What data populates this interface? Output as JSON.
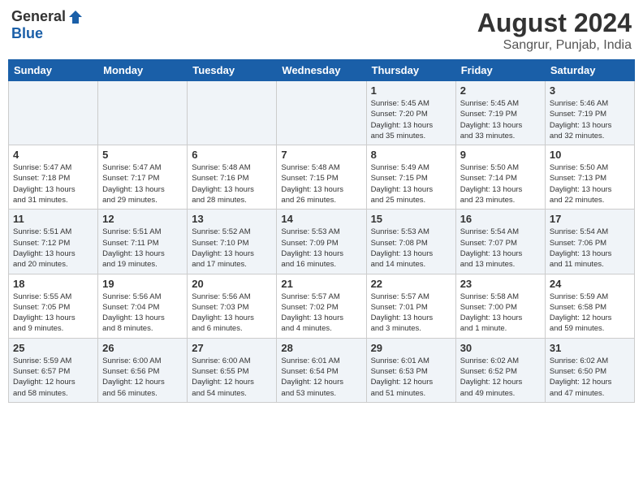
{
  "header": {
    "logo_general": "General",
    "logo_blue": "Blue",
    "month_year": "August 2024",
    "location": "Sangrur, Punjab, India"
  },
  "days_of_week": [
    "Sunday",
    "Monday",
    "Tuesday",
    "Wednesday",
    "Thursday",
    "Friday",
    "Saturday"
  ],
  "weeks": [
    [
      {
        "day": "",
        "info": ""
      },
      {
        "day": "",
        "info": ""
      },
      {
        "day": "",
        "info": ""
      },
      {
        "day": "",
        "info": ""
      },
      {
        "day": "1",
        "info": "Sunrise: 5:45 AM\nSunset: 7:20 PM\nDaylight: 13 hours\nand 35 minutes."
      },
      {
        "day": "2",
        "info": "Sunrise: 5:45 AM\nSunset: 7:19 PM\nDaylight: 13 hours\nand 33 minutes."
      },
      {
        "day": "3",
        "info": "Sunrise: 5:46 AM\nSunset: 7:19 PM\nDaylight: 13 hours\nand 32 minutes."
      }
    ],
    [
      {
        "day": "4",
        "info": "Sunrise: 5:47 AM\nSunset: 7:18 PM\nDaylight: 13 hours\nand 31 minutes."
      },
      {
        "day": "5",
        "info": "Sunrise: 5:47 AM\nSunset: 7:17 PM\nDaylight: 13 hours\nand 29 minutes."
      },
      {
        "day": "6",
        "info": "Sunrise: 5:48 AM\nSunset: 7:16 PM\nDaylight: 13 hours\nand 28 minutes."
      },
      {
        "day": "7",
        "info": "Sunrise: 5:48 AM\nSunset: 7:15 PM\nDaylight: 13 hours\nand 26 minutes."
      },
      {
        "day": "8",
        "info": "Sunrise: 5:49 AM\nSunset: 7:15 PM\nDaylight: 13 hours\nand 25 minutes."
      },
      {
        "day": "9",
        "info": "Sunrise: 5:50 AM\nSunset: 7:14 PM\nDaylight: 13 hours\nand 23 minutes."
      },
      {
        "day": "10",
        "info": "Sunrise: 5:50 AM\nSunset: 7:13 PM\nDaylight: 13 hours\nand 22 minutes."
      }
    ],
    [
      {
        "day": "11",
        "info": "Sunrise: 5:51 AM\nSunset: 7:12 PM\nDaylight: 13 hours\nand 20 minutes."
      },
      {
        "day": "12",
        "info": "Sunrise: 5:51 AM\nSunset: 7:11 PM\nDaylight: 13 hours\nand 19 minutes."
      },
      {
        "day": "13",
        "info": "Sunrise: 5:52 AM\nSunset: 7:10 PM\nDaylight: 13 hours\nand 17 minutes."
      },
      {
        "day": "14",
        "info": "Sunrise: 5:53 AM\nSunset: 7:09 PM\nDaylight: 13 hours\nand 16 minutes."
      },
      {
        "day": "15",
        "info": "Sunrise: 5:53 AM\nSunset: 7:08 PM\nDaylight: 13 hours\nand 14 minutes."
      },
      {
        "day": "16",
        "info": "Sunrise: 5:54 AM\nSunset: 7:07 PM\nDaylight: 13 hours\nand 13 minutes."
      },
      {
        "day": "17",
        "info": "Sunrise: 5:54 AM\nSunset: 7:06 PM\nDaylight: 13 hours\nand 11 minutes."
      }
    ],
    [
      {
        "day": "18",
        "info": "Sunrise: 5:55 AM\nSunset: 7:05 PM\nDaylight: 13 hours\nand 9 minutes."
      },
      {
        "day": "19",
        "info": "Sunrise: 5:56 AM\nSunset: 7:04 PM\nDaylight: 13 hours\nand 8 minutes."
      },
      {
        "day": "20",
        "info": "Sunrise: 5:56 AM\nSunset: 7:03 PM\nDaylight: 13 hours\nand 6 minutes."
      },
      {
        "day": "21",
        "info": "Sunrise: 5:57 AM\nSunset: 7:02 PM\nDaylight: 13 hours\nand 4 minutes."
      },
      {
        "day": "22",
        "info": "Sunrise: 5:57 AM\nSunset: 7:01 PM\nDaylight: 13 hours\nand 3 minutes."
      },
      {
        "day": "23",
        "info": "Sunrise: 5:58 AM\nSunset: 7:00 PM\nDaylight: 13 hours\nand 1 minute."
      },
      {
        "day": "24",
        "info": "Sunrise: 5:59 AM\nSunset: 6:58 PM\nDaylight: 12 hours\nand 59 minutes."
      }
    ],
    [
      {
        "day": "25",
        "info": "Sunrise: 5:59 AM\nSunset: 6:57 PM\nDaylight: 12 hours\nand 58 minutes."
      },
      {
        "day": "26",
        "info": "Sunrise: 6:00 AM\nSunset: 6:56 PM\nDaylight: 12 hours\nand 56 minutes."
      },
      {
        "day": "27",
        "info": "Sunrise: 6:00 AM\nSunset: 6:55 PM\nDaylight: 12 hours\nand 54 minutes."
      },
      {
        "day": "28",
        "info": "Sunrise: 6:01 AM\nSunset: 6:54 PM\nDaylight: 12 hours\nand 53 minutes."
      },
      {
        "day": "29",
        "info": "Sunrise: 6:01 AM\nSunset: 6:53 PM\nDaylight: 12 hours\nand 51 minutes."
      },
      {
        "day": "30",
        "info": "Sunrise: 6:02 AM\nSunset: 6:52 PM\nDaylight: 12 hours\nand 49 minutes."
      },
      {
        "day": "31",
        "info": "Sunrise: 6:02 AM\nSunset: 6:50 PM\nDaylight: 12 hours\nand 47 minutes."
      }
    ]
  ]
}
